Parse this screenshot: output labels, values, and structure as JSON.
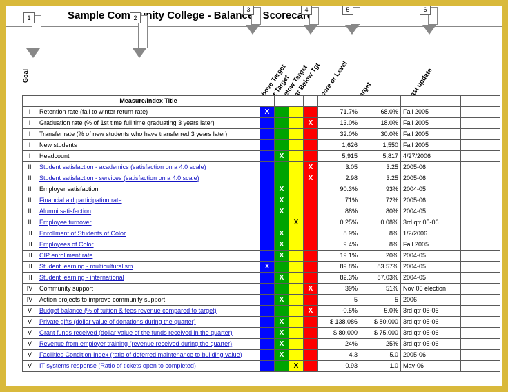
{
  "title": "Sample Community College - Balanced Scorecard",
  "arrows": [
    "1",
    "2",
    "3",
    "4",
    "5",
    "6"
  ],
  "goal_label": "Goal",
  "headers": {
    "measure": "Measure/Index Title",
    "above": "Above Target",
    "at": "At Target",
    "below": "Below Target",
    "far": "Far Below Tgt",
    "score": "Score or Level",
    "target": "Target",
    "update": "Last update"
  },
  "chart_data": {
    "type": "table",
    "columns": [
      "Goal",
      "Measure/Index Title",
      "Above Target",
      "At Target",
      "Below Target",
      "Far Below Target",
      "Score or Level",
      "Target",
      "Last update"
    ],
    "rows": [
      {
        "goal": "I",
        "title": "Retention rate (fall to winter return rate)",
        "link": false,
        "mark": "above",
        "score": "71.7%",
        "target": "68.0%",
        "update": "Fall 2005"
      },
      {
        "goal": "I",
        "title": "Graduation rate (% of 1st time full time graduating 3 years later)",
        "link": false,
        "mark": "far",
        "score": "13.0%",
        "target": "18.0%",
        "update": "Fall 2005"
      },
      {
        "goal": "I",
        "title": "Transfer rate (% of new students who have transferred 3 years later)",
        "link": false,
        "mark": "",
        "score": "32.0%",
        "target": "30.0%",
        "update": "Fall 2005"
      },
      {
        "goal": "I",
        "title": "New students",
        "link": false,
        "mark": "",
        "score": "1,626",
        "target": "1,550",
        "update": "Fall 2005"
      },
      {
        "goal": "I",
        "title": "Headcount",
        "link": false,
        "mark": "at",
        "score": "5,915",
        "target": "5,817",
        "update": "4/27/2006"
      },
      {
        "goal": "II",
        "title": "Student satisfaction - academics (satisfaction on a 4.0 scale)",
        "link": true,
        "mark": "far",
        "score": "3.05",
        "target": "3.25",
        "update": "2005-06"
      },
      {
        "goal": "II",
        "title": "Student satisfaction - services (satisfaction on a 4.0 scale)",
        "link": true,
        "mark": "far",
        "score": "2.98",
        "target": "3.25",
        "update": "2005-06"
      },
      {
        "goal": "II",
        "title": "Employer satisfaction",
        "link": false,
        "mark": "at",
        "score": "90.3%",
        "target": "93%",
        "update": "2004-05"
      },
      {
        "goal": "II",
        "title": "Financial aid participation rate",
        "link": true,
        "mark": "at",
        "score": "71%",
        "target": "72%",
        "update": "2005-06"
      },
      {
        "goal": "II",
        "title": "Alumni satisfaction",
        "link": true,
        "mark": "at",
        "score": "88%",
        "target": "80%",
        "update": "2004-05"
      },
      {
        "goal": "II",
        "title": "Employee turnover",
        "link": true,
        "mark": "below",
        "score": "0.25%",
        "target": "0.08%",
        "update": "3rd qtr 05-06"
      },
      {
        "goal": "III",
        "title": "Enrollment of Students of Color",
        "link": true,
        "mark": "at",
        "score": "8.9%",
        "target": "8%",
        "update": "1/2/2006"
      },
      {
        "goal": "III",
        "title": "Employees of Color",
        "link": true,
        "mark": "at",
        "score": "9.4%",
        "target": "8%",
        "update": "Fall 2005"
      },
      {
        "goal": "III",
        "title": "CIP enrollment rate",
        "link": true,
        "mark": "at",
        "score": "19.1%",
        "target": "20%",
        "update": "2004-05"
      },
      {
        "goal": "III",
        "title": "Student learning - multiculturalism",
        "link": true,
        "mark": "above",
        "score": "89.8%",
        "target": "83.57%",
        "update": "2004-05"
      },
      {
        "goal": "III",
        "title": "Student learning - international",
        "link": true,
        "mark": "at",
        "score": "82.3%",
        "target": "87.03%",
        "update": "2004-05"
      },
      {
        "goal": "IV",
        "title": "Community support",
        "link": false,
        "mark": "far",
        "score": "39%",
        "target": "51%",
        "update": "Nov 05 election"
      },
      {
        "goal": "IV",
        "title": "Action projects to improve community support",
        "link": false,
        "mark": "at",
        "score": "5",
        "target": "5",
        "update": "2006"
      },
      {
        "goal": "V",
        "title": "Budget balance (% of tuition & fees revenue compared to target)",
        "link": true,
        "mark": "far",
        "score": "-0.5%",
        "target": "5.0%",
        "update": "3rd qtr 05-06"
      },
      {
        "goal": "V",
        "title": "Private gifts (dollar value of donations during the quarter)",
        "link": true,
        "mark": "at",
        "score": "$ 138,086",
        "target": "$ 80,000",
        "update": "3rd qtr 05-06"
      },
      {
        "goal": "V",
        "title": "Grant funds received (dollar value of the funds received in the quarter)",
        "link": true,
        "mark": "at",
        "score": "$   80,000",
        "target": "$ 75,000",
        "update": "3rd qtr 05-06"
      },
      {
        "goal": "V",
        "title": "Revenue from employer training (revenue received during the quarter)",
        "link": true,
        "mark": "at",
        "score": "24%",
        "target": "25%",
        "update": "3rd qtr 05-06"
      },
      {
        "goal": "V",
        "title": "Facilities Condition Index (ratio of deferred maintenance to building value)",
        "link": true,
        "mark": "at",
        "score": "4.3",
        "target": "5.0",
        "update": "2005-06"
      },
      {
        "goal": "V",
        "title": "IT systems response (Ratio of tickets open to completed)",
        "link": true,
        "mark": "below",
        "score": "0.93",
        "target": "1.0",
        "update": "May-06"
      }
    ]
  }
}
